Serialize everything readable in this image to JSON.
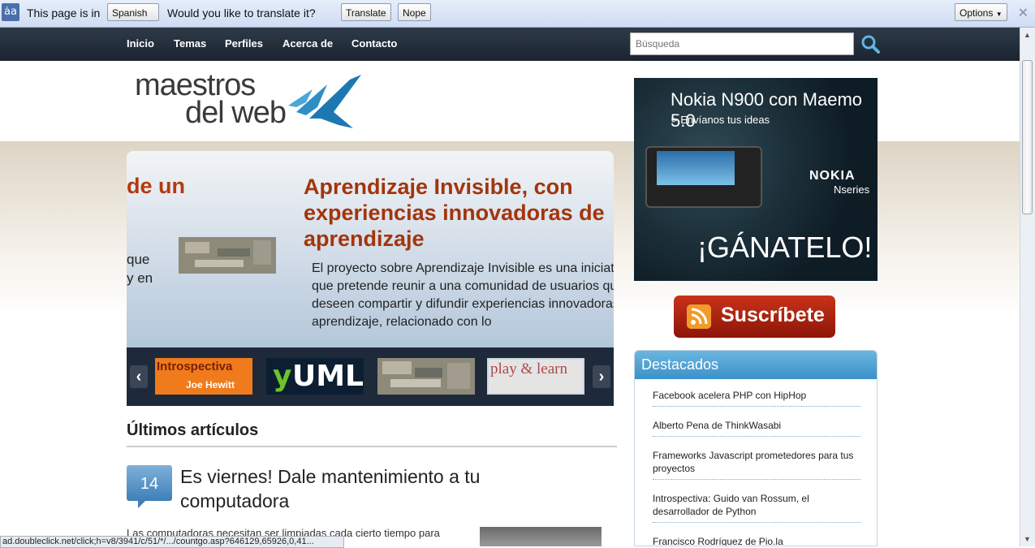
{
  "translate_bar": {
    "prefix": "This page is in",
    "language": "Spanish",
    "question": "Would you like to translate it?",
    "translate_label": "Translate",
    "nope_label": "Nope",
    "options_label": "Options",
    "close_label": "✕",
    "icon_text": "ȧa"
  },
  "nav": {
    "items": [
      "Inicio",
      "Temas",
      "Perfiles",
      "Acerca de",
      "Contacto"
    ],
    "search_placeholder": "Búsqueda"
  },
  "logo": {
    "line1": "maestros",
    "line2": "del web"
  },
  "slider": {
    "prev_heading": "de un",
    "prev_text1": "que",
    "prev_text2": "y en",
    "title": "Aprendizaje Invisible, con experiencias innovadoras de aprendizaje",
    "text": "El proyecto sobre Aprendizaje Invisible es una iniciativa que pretende reunir a una comunidad de usuarios que deseen compartir y difundir experiencias innovadoras de aprendizaje, relacionado con lo"
  },
  "thumbs": {
    "t1_line1": "Introspectiva",
    "t1_line2": "Joe Hewitt",
    "t2_y": "y",
    "t2_rest": "UML",
    "t4": "play & learn"
  },
  "latest": {
    "section_title": "Últimos artículos",
    "day": "14",
    "article_title": "Es viernes! Dale mantenimiento a tu computadora",
    "article_text": "Las computadoras necesitan ser limpiadas cada cierto tiempo para"
  },
  "status_text": "ad.doubleclick.net/click;h=v8/3941/c/51/*/.../countgo.asp?646129,65926,0,41...",
  "ad": {
    "title": "Nokia N900 con Maemo 5.0",
    "subtitle": "> Envíanos tus ideas",
    "brand": "NOKIA",
    "brand_line": "Nseries",
    "cta": "¡GÁNATELO!"
  },
  "subscribe_label": "Suscríbete",
  "destacados": {
    "title": "Destacados",
    "items": [
      "Facebook acelera PHP con HipHop",
      "Alberto Pena de ThinkWasabi",
      "Frameworks Javascript prometedores para tus proyectos",
      "Introspectiva: Guido van Rossum, el desarrollador de Python",
      "Francisco Rodríguez de Pio.la"
    ]
  },
  "colors": {
    "nav_bg": "#1b2430",
    "accent_blue": "#3a91c9",
    "title_orange": "#a3350c",
    "subscribe_red": "#c8331a"
  }
}
